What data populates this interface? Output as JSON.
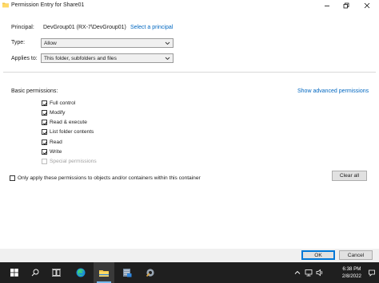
{
  "window": {
    "title": "Permission Entry for Share01"
  },
  "principal": {
    "label": "Principal:",
    "value": "DevGroup01 (RX-7\\DevGroup01)",
    "select_link": "Select a principal"
  },
  "type": {
    "label": "Type:",
    "value": "Allow"
  },
  "applies_to": {
    "label": "Applies to:",
    "value": "This folder, subfolders and files"
  },
  "permissions": {
    "heading": "Basic permissions:",
    "advanced_link": "Show advanced permissions",
    "items": [
      {
        "label": "Full control",
        "checked": true,
        "enabled": true
      },
      {
        "label": "Modify",
        "checked": true,
        "enabled": true
      },
      {
        "label": "Read & execute",
        "checked": true,
        "enabled": true
      },
      {
        "label": "List folder contents",
        "checked": true,
        "enabled": true
      },
      {
        "label": "Read",
        "checked": true,
        "enabled": true
      },
      {
        "label": "Write",
        "checked": true,
        "enabled": true
      },
      {
        "label": "Special permissions",
        "checked": false,
        "enabled": false
      }
    ]
  },
  "only_apply": {
    "label": "Only apply these permissions to objects and/or containers within this container",
    "checked": false
  },
  "buttons": {
    "clear_all": "Clear all",
    "ok": "OK",
    "cancel": "Cancel"
  },
  "taskbar": {
    "time": "6:38 PM",
    "date": "2/8/2022",
    "apps": [
      "start-icon",
      "search-icon",
      "task-view-icon",
      "edge-icon",
      "file-explorer-icon",
      "server-manager-icon",
      "settings-icon"
    ]
  },
  "colors": {
    "link": "#0067c0",
    "accent": "#0078d7",
    "taskbar": "#1f1f1f"
  }
}
